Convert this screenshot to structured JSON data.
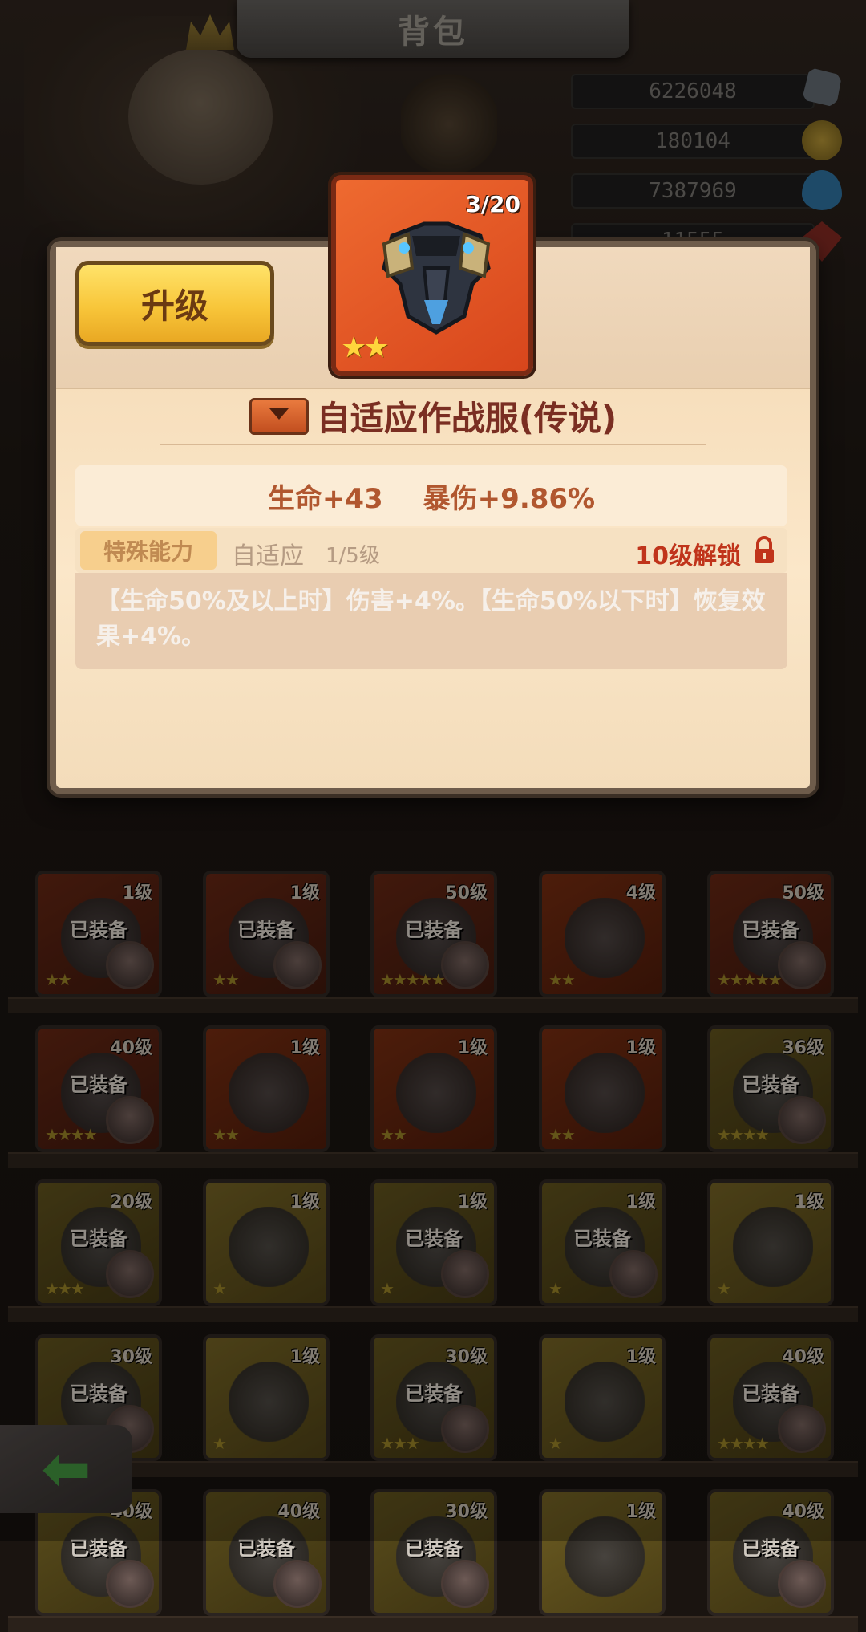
{
  "header": {
    "title": "背包"
  },
  "currencies": [
    {
      "value": "6226048",
      "icon": "ore-icon",
      "color": "#7c8590"
    },
    {
      "value": "180104",
      "icon": "gold-coin-icon",
      "color": "#b89a3a"
    },
    {
      "value": "7387969",
      "icon": "water-drop-icon",
      "color": "#3b8fc6"
    },
    {
      "value": "11555",
      "icon": "red-gem-icon",
      "color": "#a8342a"
    }
  ],
  "popup": {
    "upgrade_label": "升级",
    "item_count": "3/20",
    "item_name": "自适应作战服(传说)",
    "stars": "★★",
    "stats": [
      "生命+43",
      "暴伤+9.86%"
    ],
    "ability_tag": "特殊能力",
    "ability_name": "自适应",
    "ability_level": "1/5级",
    "unlock_text": "10级解锁",
    "description": "【生命50%及以上时】伤害+4%。【生命50%以下时】恢复效果+4%。"
  },
  "grid": {
    "equipped_label": "已装备",
    "rows": [
      [
        {
          "level": "1级",
          "equipped": true,
          "stars": "★★",
          "rarity": "red"
        },
        {
          "level": "1级",
          "equipped": true,
          "stars": "★★",
          "rarity": "red"
        },
        {
          "level": "50级",
          "equipped": true,
          "stars": "★★★★★",
          "rarity": "red"
        },
        {
          "level": "4级",
          "equipped": false,
          "stars": "★★",
          "rarity": "redb"
        },
        {
          "level": "50级",
          "equipped": true,
          "stars": "★★★★★",
          "rarity": "red"
        }
      ],
      [
        {
          "level": "40级",
          "equipped": true,
          "stars": "★★★★",
          "rarity": "red"
        },
        {
          "level": "1级",
          "equipped": false,
          "stars": "★★",
          "rarity": "redb"
        },
        {
          "level": "1级",
          "equipped": false,
          "stars": "★★",
          "rarity": "redb"
        },
        {
          "level": "1级",
          "equipped": false,
          "stars": "★★",
          "rarity": "redb"
        },
        {
          "level": "36级",
          "equipped": true,
          "stars": "★★★★",
          "rarity": "gold"
        }
      ],
      [
        {
          "level": "20级",
          "equipped": true,
          "stars": "★★★",
          "rarity": "gold"
        },
        {
          "level": "1级",
          "equipped": false,
          "stars": "★",
          "rarity": "goldb"
        },
        {
          "level": "1级",
          "equipped": true,
          "stars": "★",
          "rarity": "gold"
        },
        {
          "level": "1级",
          "equipped": true,
          "stars": "★",
          "rarity": "gold"
        },
        {
          "level": "1级",
          "equipped": false,
          "stars": "★",
          "rarity": "goldb"
        }
      ],
      [
        {
          "level": "30级",
          "equipped": true,
          "stars": "★★★",
          "rarity": "gold"
        },
        {
          "level": "1级",
          "equipped": false,
          "stars": "★",
          "rarity": "goldb"
        },
        {
          "level": "30级",
          "equipped": true,
          "stars": "★★★",
          "rarity": "gold"
        },
        {
          "level": "1级",
          "equipped": false,
          "stars": "★",
          "rarity": "goldb"
        },
        {
          "level": "40级",
          "equipped": true,
          "stars": "★★★★",
          "rarity": "gold"
        }
      ],
      [
        {
          "level": "40级",
          "equipped": true,
          "stars": "",
          "rarity": "gold"
        },
        {
          "level": "40级",
          "equipped": true,
          "stars": "",
          "rarity": "gold"
        },
        {
          "level": "30级",
          "equipped": true,
          "stars": "",
          "rarity": "gold"
        },
        {
          "level": "1级",
          "equipped": false,
          "stars": "",
          "rarity": "goldb"
        },
        {
          "level": "40级",
          "equipped": true,
          "stars": "",
          "rarity": "gold"
        }
      ]
    ]
  },
  "back_button": {
    "icon": "back-arrow-icon"
  }
}
